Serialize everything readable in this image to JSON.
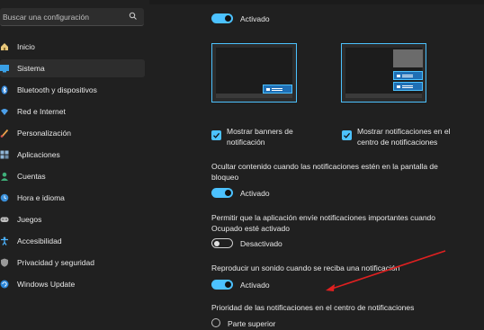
{
  "search": {
    "placeholder": "Buscar una configuración"
  },
  "nav": [
    {
      "label": "Inicio",
      "icon": "home-icon"
    },
    {
      "label": "Sistema",
      "icon": "system-icon"
    },
    {
      "label": "Bluetooth y dispositivos",
      "icon": "bluetooth-icon"
    },
    {
      "label": "Red e Internet",
      "icon": "network-icon"
    },
    {
      "label": "Personalización",
      "icon": "brush-icon"
    },
    {
      "label": "Aplicaciones",
      "icon": "apps-icon"
    },
    {
      "label": "Cuentas",
      "icon": "account-icon"
    },
    {
      "label": "Hora e idioma",
      "icon": "globe-clock-icon"
    },
    {
      "label": "Juegos",
      "icon": "gamepad-icon"
    },
    {
      "label": "Accesibilidad",
      "icon": "accessibility-icon"
    },
    {
      "label": "Privacidad y seguridad",
      "icon": "shield-icon"
    },
    {
      "label": "Windows Update",
      "icon": "update-icon"
    }
  ],
  "selected_nav": "Sistema",
  "main": {
    "top_toggle": {
      "label": "Activado",
      "state": "on"
    },
    "check_banners": {
      "line1": "Mostrar banners de",
      "line2": "notificación",
      "checked": true
    },
    "check_center": {
      "line1": "Mostrar notificaciones en el",
      "line2": "centro de notificaciones",
      "checked": true
    },
    "lock_screen": {
      "text1": "Ocultar contenido cuando las notificaciones estén en la pantalla de",
      "text2": "bloqueo",
      "toggle_label": "Activado",
      "state": "on"
    },
    "busy": {
      "text1": "Permitir que la aplicación envíe notificaciones importantes cuando",
      "text2": "Ocupado esté activado",
      "toggle_label": "Desactivado",
      "state": "off"
    },
    "sound": {
      "text1": "Reproducir un sonido cuando se reciba una notificación",
      "toggle_label": "Activado",
      "state": "on"
    },
    "priority": {
      "text1": "Prioridad de las notificaciones en el centro de notificaciones",
      "option1": "Parte superior"
    }
  },
  "colors": {
    "accent": "#4cc2ff",
    "background": "#202020",
    "arrow": "#e02020"
  }
}
